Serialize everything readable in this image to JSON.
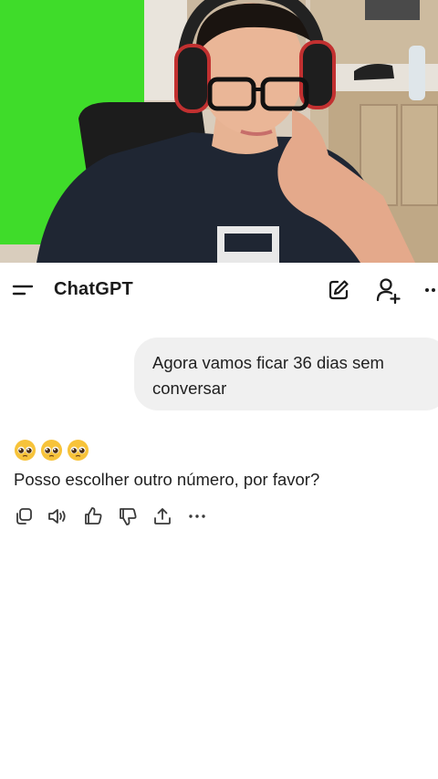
{
  "app": {
    "title": "ChatGPT"
  },
  "header_icons": {
    "menu": "menu-icon",
    "new_chat": "edit-icon",
    "add_user": "add-user-icon",
    "more": "more-icon"
  },
  "conversation": {
    "user_message": "Agora vamos ficar 36 dias sem conversar",
    "assistant_emojis": [
      "pleading-face",
      "pleading-face",
      "pleading-face"
    ],
    "assistant_message": "Posso escolher outro número, por favor?"
  },
  "message_actions": [
    "copy-icon",
    "read-aloud-icon",
    "thumbs-up-icon",
    "thumbs-down-icon",
    "share-icon",
    "more-icon"
  ],
  "colors": {
    "bubble_bg": "#f0f0f0",
    "text": "#1f1f1f",
    "green_screen": "#3fdc2a"
  }
}
